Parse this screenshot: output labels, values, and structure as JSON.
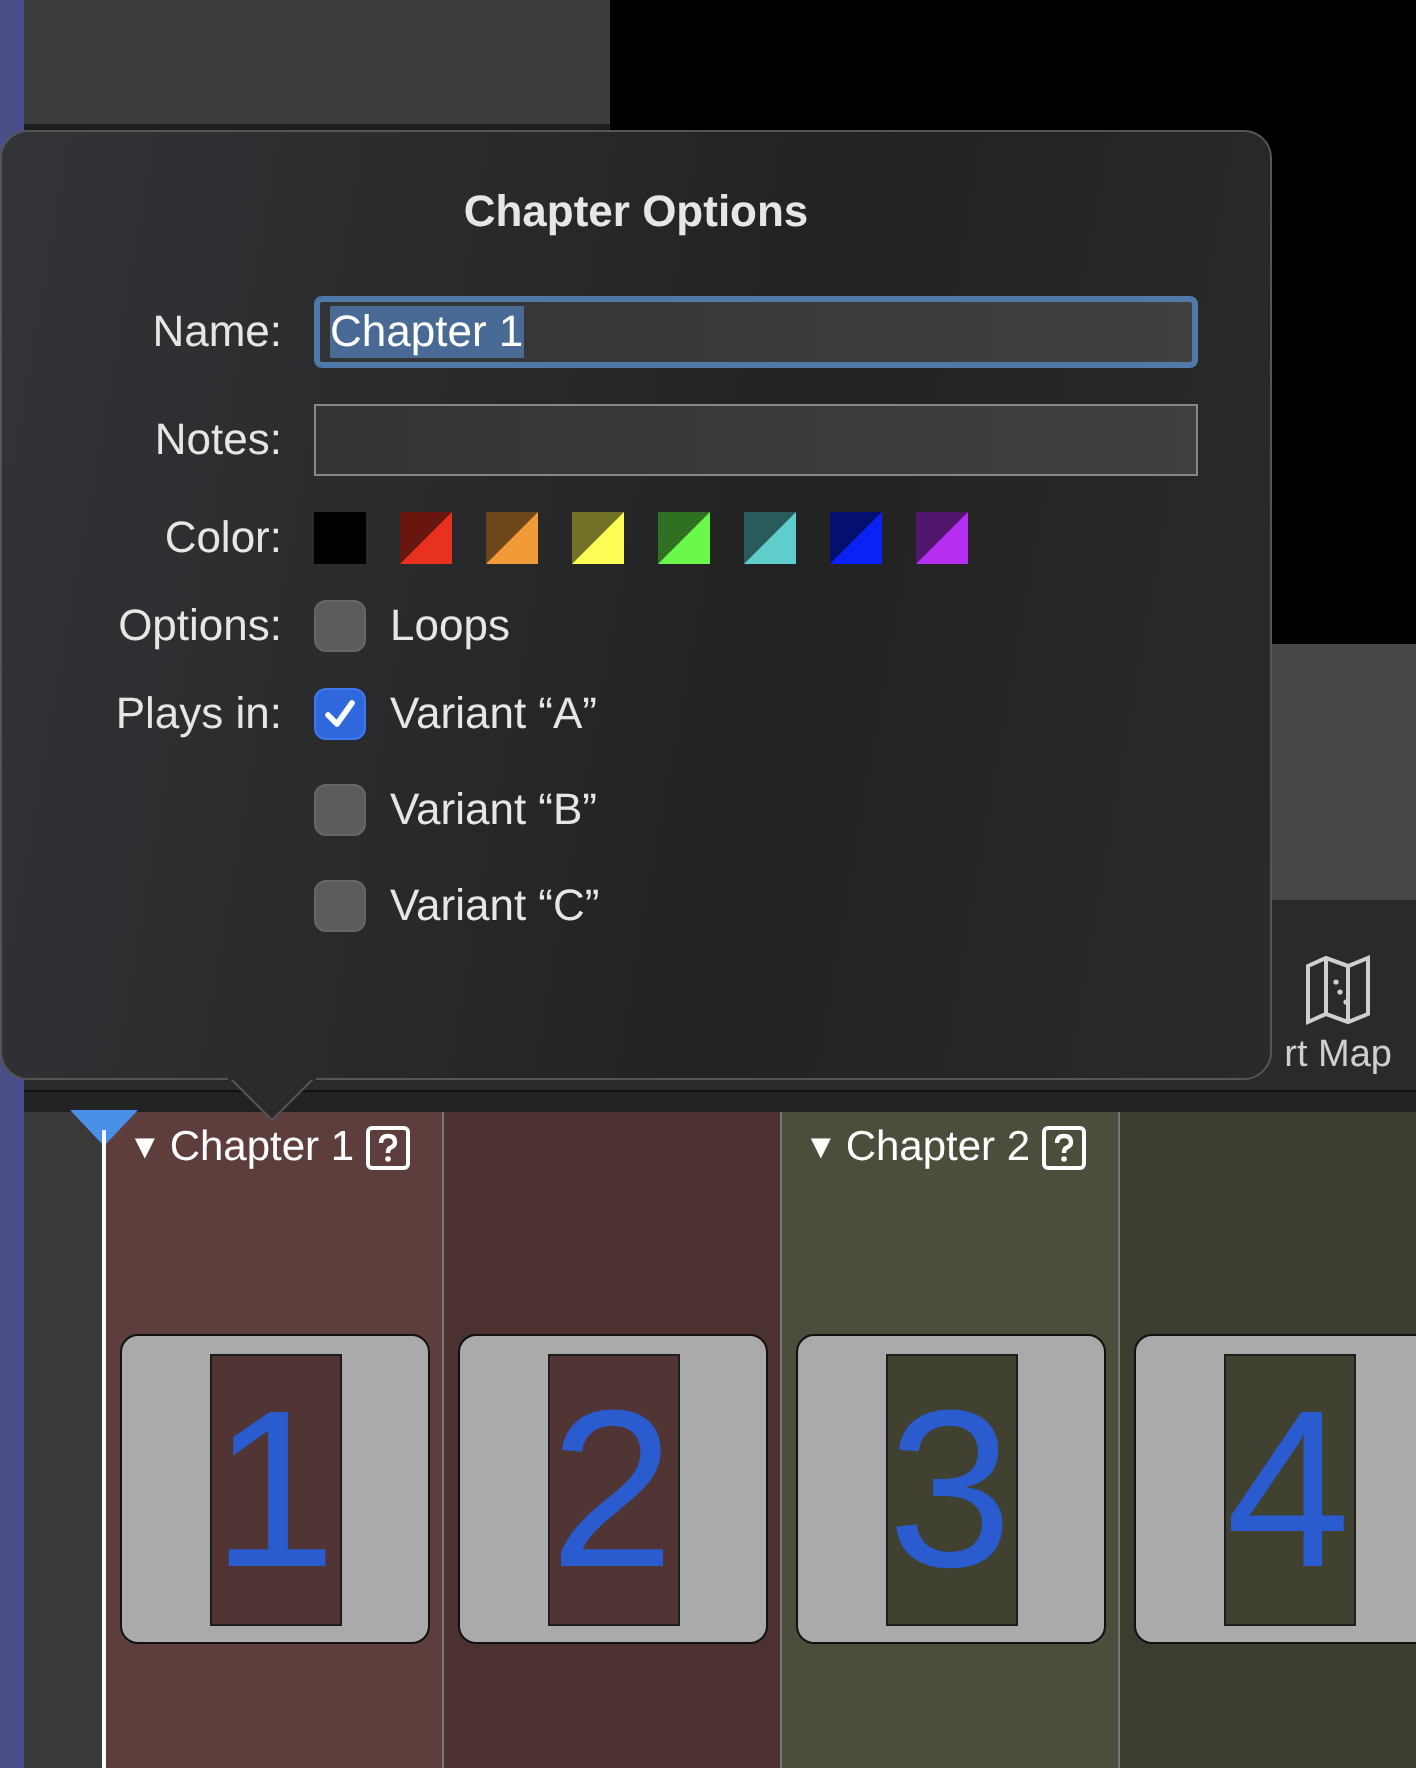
{
  "toolbar": {
    "label": "rt Map"
  },
  "popover": {
    "title": "Chapter Options",
    "name": {
      "label": "Name:",
      "value": "Chapter 1"
    },
    "notes": {
      "label": "Notes:"
    },
    "color": {
      "label": "Color:",
      "swatches": [
        {
          "color": "#000000"
        },
        {
          "color": "#e8311f"
        },
        {
          "color": "#f09a38"
        },
        {
          "color": "#fdfd55"
        },
        {
          "color": "#6cf84a"
        },
        {
          "color": "#5ecdcb"
        },
        {
          "color": "#0a22f5"
        },
        {
          "color": "#b42ff0"
        }
      ]
    },
    "options": {
      "label": "Options:",
      "items": [
        {
          "label": "Loops",
          "checked": false
        }
      ]
    },
    "plays_in": {
      "label": "Plays in:",
      "items": [
        {
          "label": "Variant “A”",
          "checked": true
        },
        {
          "label": "Variant “B”",
          "checked": false
        },
        {
          "label": "Variant “C”",
          "checked": false
        }
      ]
    }
  },
  "timeline": {
    "chapters": [
      {
        "toggle": "▼",
        "title": "Chapter 1",
        "color": "#5e3e3d",
        "thumbs": [
          "1",
          "2"
        ]
      },
      {
        "toggle": "▼",
        "title": "Chapter 2",
        "color": "#4c4d3a",
        "thumbs": [
          "3",
          "4"
        ]
      }
    ]
  }
}
